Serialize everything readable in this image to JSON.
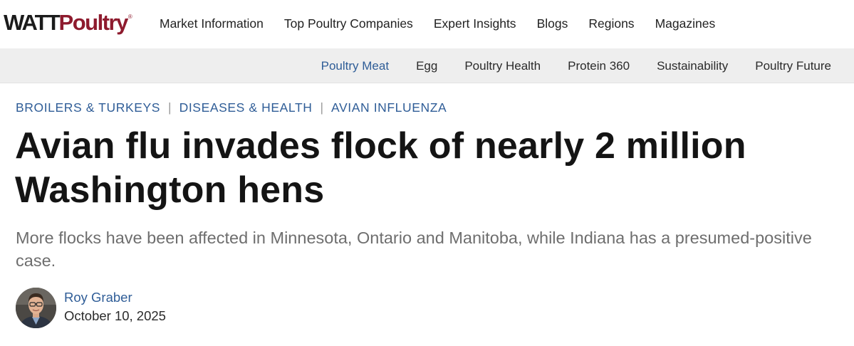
{
  "header": {
    "logo": {
      "part1": "WATT",
      "part2": "Poultry",
      "reg": "®"
    },
    "nav": [
      {
        "label": "Market Information"
      },
      {
        "label": "Top Poultry Companies"
      },
      {
        "label": "Expert Insights"
      },
      {
        "label": "Blogs"
      },
      {
        "label": "Regions"
      },
      {
        "label": "Magazines"
      }
    ]
  },
  "subnav": {
    "items": [
      {
        "label": "Poultry Meat",
        "active": true
      },
      {
        "label": "Egg"
      },
      {
        "label": "Poultry Health"
      },
      {
        "label": "Protein 360"
      },
      {
        "label": "Sustainability"
      },
      {
        "label": "Poultry Future"
      }
    ]
  },
  "article": {
    "breadcrumbs": [
      "BROILERS & TURKEYS",
      "DISEASES & HEALTH",
      "AVIAN INFLUENZA"
    ],
    "separator": "|",
    "title": "Avian flu invades flock of nearly 2 million Washington hens",
    "dek": "More flocks have been affected in Minnesota, Ontario and Manitoba, while Indiana has a presumed-positive case.",
    "author": {
      "name": "Roy Graber",
      "avatar_icon": "author-photo"
    },
    "date": "October 10, 2025"
  },
  "colors": {
    "brand_red": "#8e1b2e",
    "link_blue": "#2f5d97",
    "subnav_bg": "#eeeeee",
    "dek_gray": "#6e6e6e"
  }
}
